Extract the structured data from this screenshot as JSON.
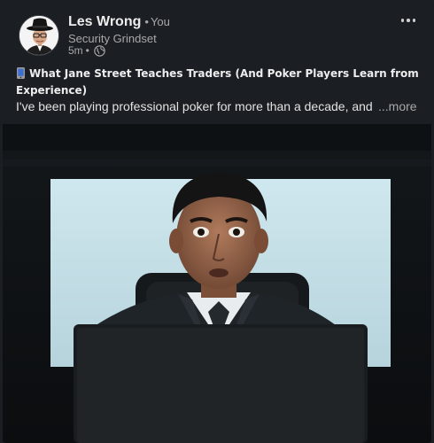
{
  "post": {
    "author": {
      "name": "Les Wrong",
      "relation": "You",
      "headline": "Security Grindset",
      "time": "5m",
      "visibility_icon": "globe-icon"
    },
    "title_icon": "mobile-phone-icon",
    "title": "What Jane Street Teaches Traders (And Poker Players Learn from Experience)",
    "body": "I've been playing professional poker for more than a decade, and",
    "more_label": "...more",
    "overflow_icon": "ellipsis-icon"
  },
  "colors": {
    "background": "#1b1f23",
    "primary_text": "#ededed",
    "secondary_text": "#a8a8a8",
    "screen_glow": "#c8e4ec"
  }
}
